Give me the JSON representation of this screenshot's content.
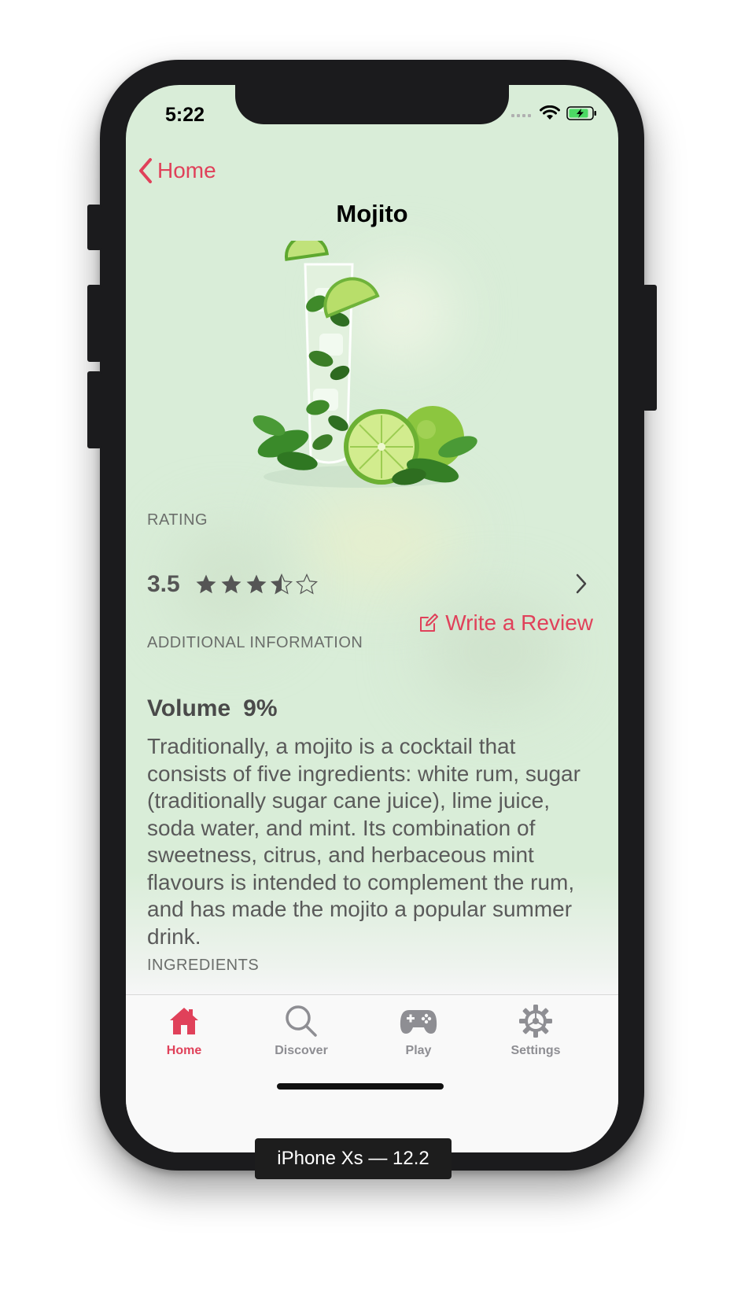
{
  "status_bar": {
    "time": "5:22"
  },
  "nav": {
    "back_label": "Home",
    "title": "Mojito"
  },
  "rating": {
    "section_label": "RATING",
    "value": "3.5",
    "stars": 3.5,
    "max_stars": 5,
    "write_review_label": "Write a Review"
  },
  "info": {
    "section_label": "ADDITIONAL INFORMATION",
    "volume_label": "Volume",
    "volume_value": "9%",
    "description": "Traditionally, a mojito is a cocktail that consists of five ingredients: white rum, sugar (traditionally sugar cane juice), lime juice, soda water, and mint. Its combination of sweetness, citrus, and herbaceous mint flavours is intended to complement the rum, and has made the mojito a popular summer drink."
  },
  "ingredients": {
    "section_label": "INGREDIENTS"
  },
  "tabbar": {
    "tabs": [
      {
        "label": "Home",
        "icon": "house-icon",
        "active": true
      },
      {
        "label": "Discover",
        "icon": "search-icon",
        "active": false
      },
      {
        "label": "Play",
        "icon": "gamepad-icon",
        "active": false
      },
      {
        "label": "Settings",
        "icon": "gear-icon",
        "active": false
      }
    ]
  },
  "simulator": {
    "device_label": "iPhone Xs — 12.2"
  },
  "colors": {
    "accent": "#e0415a",
    "inactive_tab": "#8e8e93",
    "background_green": "#d9edd8"
  }
}
